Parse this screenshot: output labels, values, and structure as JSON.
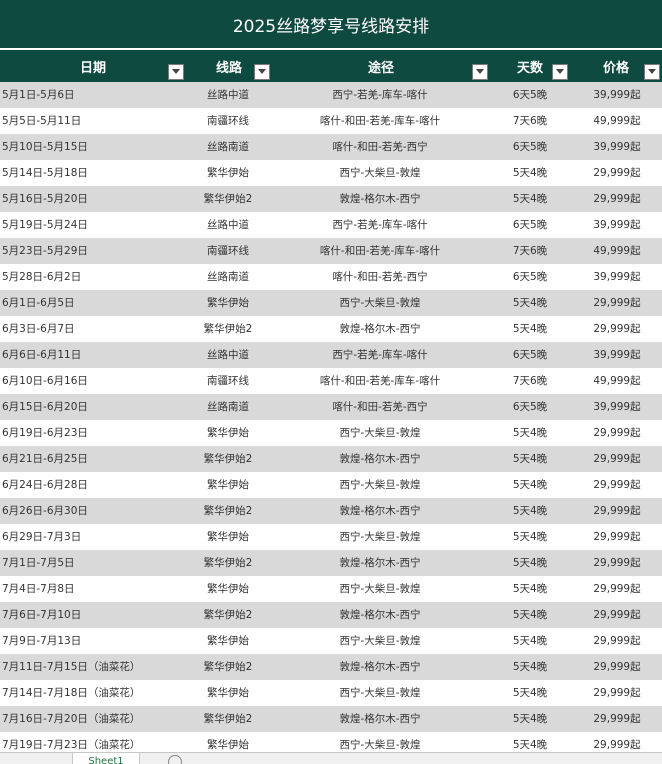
{
  "title": "2025丝路梦享号线路安排",
  "columns": [
    "日期",
    "线路",
    "途径",
    "天数",
    "价格"
  ],
  "rows": [
    [
      "5月1日-5月6日",
      "丝路中道",
      "西宁-若羌-库车-喀什",
      "6天5晚",
      "39,999起"
    ],
    [
      "5月5日-5月11日",
      "南疆环线",
      "喀什-和田-若羌-库车-喀什",
      "7天6晚",
      "49,999起"
    ],
    [
      "5月10日-5月15日",
      "丝路南道",
      "喀什-和田-若羌-西宁",
      "6天5晚",
      "39,999起"
    ],
    [
      "5月14日-5月18日",
      "繁华伊始",
      "西宁-大柴旦-敦煌",
      "5天4晚",
      "29,999起"
    ],
    [
      "5月16日-5月20日",
      "繁华伊始2",
      "敦煌-格尔木-西宁",
      "5天4晚",
      "29,999起"
    ],
    [
      "5月19日-5月24日",
      "丝路中道",
      "西宁-若羌-库车-喀什",
      "6天5晚",
      "39,999起"
    ],
    [
      "5月23日-5月29日",
      "南疆环线",
      "喀什-和田-若羌-库车-喀什",
      "7天6晚",
      "49,999起"
    ],
    [
      "5月28日-6月2日",
      "丝路南道",
      "喀什-和田-若羌-西宁",
      "6天5晚",
      "39,999起"
    ],
    [
      "6月1日-6月5日",
      "繁华伊始",
      "西宁-大柴旦-敦煌",
      "5天4晚",
      "29,999起"
    ],
    [
      "6月3日-6月7日",
      "繁华伊始2",
      "敦煌-格尔木-西宁",
      "5天4晚",
      "29,999起"
    ],
    [
      "6月6日-6月11日",
      "丝路中道",
      "西宁-若羌-库车-喀什",
      "6天5晚",
      "39,999起"
    ],
    [
      "6月10日-6月16日",
      "南疆环线",
      "喀什-和田-若羌-库车-喀什",
      "7天6晚",
      "49,999起"
    ],
    [
      "6月15日-6月20日",
      "丝路南道",
      "喀什-和田-若羌-西宁",
      "6天5晚",
      "39,999起"
    ],
    [
      "6月19日-6月23日",
      "繁华伊始",
      "西宁-大柴旦-敦煌",
      "5天4晚",
      "29,999起"
    ],
    [
      "6月21日-6月25日",
      "繁华伊始2",
      "敦煌-格尔木-西宁",
      "5天4晚",
      "29,999起"
    ],
    [
      "6月24日-6月28日",
      "繁华伊始",
      "西宁-大柴旦-敦煌",
      "5天4晚",
      "29,999起"
    ],
    [
      "6月26日-6月30日",
      "繁华伊始2",
      "敦煌-格尔木-西宁",
      "5天4晚",
      "29,999起"
    ],
    [
      "6月29日-7月3日",
      "繁华伊始",
      "西宁-大柴旦-敦煌",
      "5天4晚",
      "29,999起"
    ],
    [
      "7月1日-7月5日",
      "繁华伊始2",
      "敦煌-格尔木-西宁",
      "5天4晚",
      "29,999起"
    ],
    [
      "7月4日-7月8日",
      "繁华伊始",
      "西宁-大柴旦-敦煌",
      "5天4晚",
      "29,999起"
    ],
    [
      "7月6日-7月10日",
      "繁华伊始2",
      "敦煌-格尔木-西宁",
      "5天4晚",
      "29,999起"
    ],
    [
      "7月9日-7月13日",
      "繁华伊始",
      "西宁-大柴旦-敦煌",
      "5天4晚",
      "29,999起"
    ],
    [
      "7月11日-7月15日（油菜花）",
      "繁华伊始2",
      "敦煌-格尔木-西宁",
      "5天4晚",
      "29,999起"
    ],
    [
      "7月14日-7月18日（油菜花）",
      "繁华伊始",
      "西宁-大柴旦-敦煌",
      "5天4晚",
      "29,999起"
    ],
    [
      "7月16日-7月20日（油菜花）",
      "繁华伊始2",
      "敦煌-格尔木-西宁",
      "5天4晚",
      "29,999起"
    ],
    [
      "7月19日-7月23日（油菜花）",
      "繁华伊始",
      "西宁-大柴旦-敦煌",
      "5天4晚",
      "29,999起"
    ]
  ],
  "sheet_tab": "Sheet1",
  "colors": {
    "header_bg": "#0f4a40",
    "band": "#d9d9d9"
  },
  "icons": {
    "filter": "dropdown-arrow-icon",
    "add_sheet": "plus-circle-icon"
  }
}
